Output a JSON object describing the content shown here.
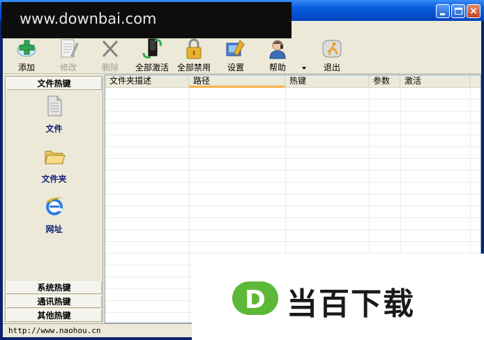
{
  "watermark": {
    "site": "www.downbai.com",
    "brand": "当百下载",
    "logo_letter": "D"
  },
  "window_controls": {
    "close_glyph": "×"
  },
  "toolbar": {
    "add": "添加",
    "edit": "修改",
    "delete": "删除",
    "enable_all": "全部激活",
    "disable_all": "全部禁用",
    "settings": "设置",
    "help": "帮助",
    "exit": "退出"
  },
  "left_panel": {
    "top_header": "文件热键",
    "items": [
      {
        "label": "文件",
        "icon": "file-icon"
      },
      {
        "label": "文件夹",
        "icon": "folder-icon"
      },
      {
        "label": "网址",
        "icon": "ie-icon"
      }
    ],
    "bottom_headers": [
      "系统热键",
      "通讯热键",
      "其他热键"
    ]
  },
  "list": {
    "columns": [
      "文件夹描述",
      "路径",
      "热键",
      "参数",
      "激活"
    ],
    "sorted_column": "路径"
  },
  "status": {
    "text": "http://www.naohou.cn"
  },
  "colors": {
    "title_bar": "#0550d0",
    "panel_bg": "#ece9d8",
    "link_text": "#0a1e78",
    "sort_indicator": "#f9b247"
  }
}
